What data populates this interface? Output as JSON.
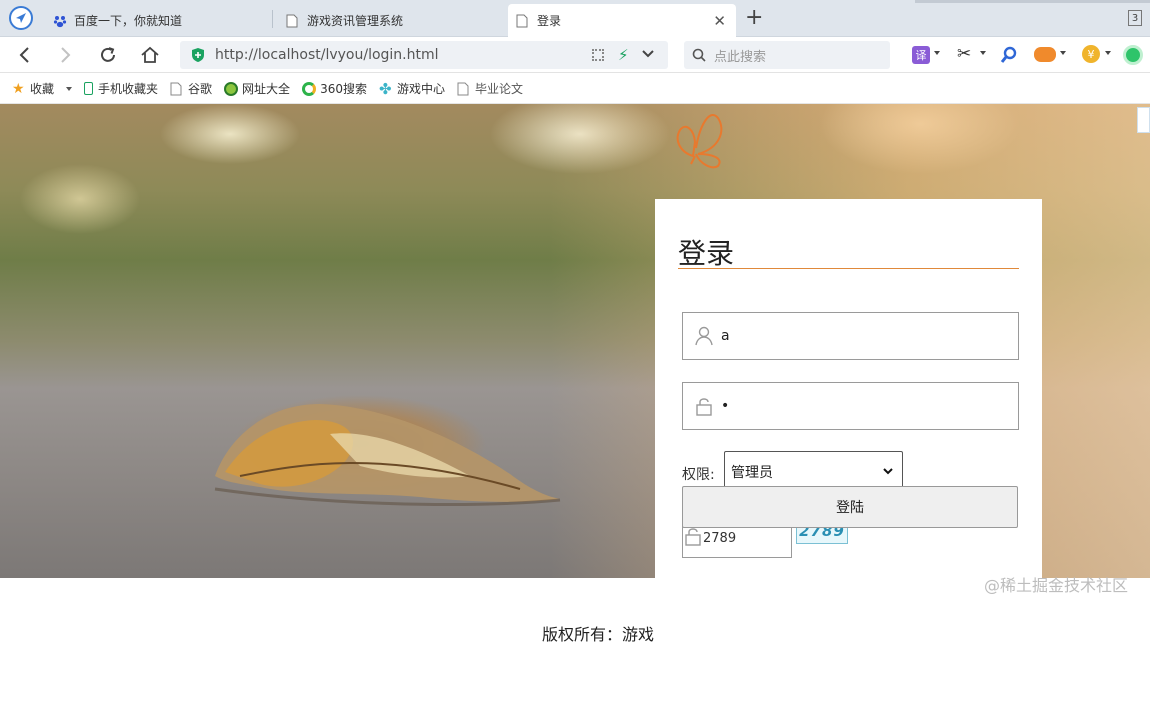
{
  "browser": {
    "tabs": [
      {
        "title": "百度一下，你就知道",
        "icon": "baidu-paw-icon",
        "active": false
      },
      {
        "title": "游戏资讯管理系统",
        "icon": "page-icon",
        "active": false
      },
      {
        "title": "登录",
        "icon": "page-icon",
        "active": true
      }
    ],
    "tab_count": "3",
    "address": {
      "url": "http://localhost/lvyou/login.html"
    },
    "search": {
      "placeholder": "点此搜索"
    },
    "bookmarks": [
      {
        "label": "收藏",
        "icon": "star-icon"
      },
      {
        "label": "手机收藏夹",
        "icon": "phone-icon"
      },
      {
        "label": "谷歌",
        "icon": "page-icon"
      },
      {
        "label": "网址大全",
        "icon": "globe-icon"
      },
      {
        "label": "360搜索",
        "icon": "search-360-icon"
      },
      {
        "label": "游戏中心",
        "icon": "game-icon"
      },
      {
        "label": "毕业论文",
        "icon": "page-icon"
      }
    ],
    "accent": "#1aa260"
  },
  "login": {
    "title": "登录",
    "username": "a",
    "password_masked": "•",
    "role_label": "权限:",
    "role_selected": "管理员",
    "code_value": "2789",
    "captcha_text": "2789",
    "submit_label": "登陆",
    "title_underline_color": "#e0893a"
  },
  "footer": {
    "text": "版权所有：游戏"
  },
  "watermark": "@稀土掘金技术社区"
}
